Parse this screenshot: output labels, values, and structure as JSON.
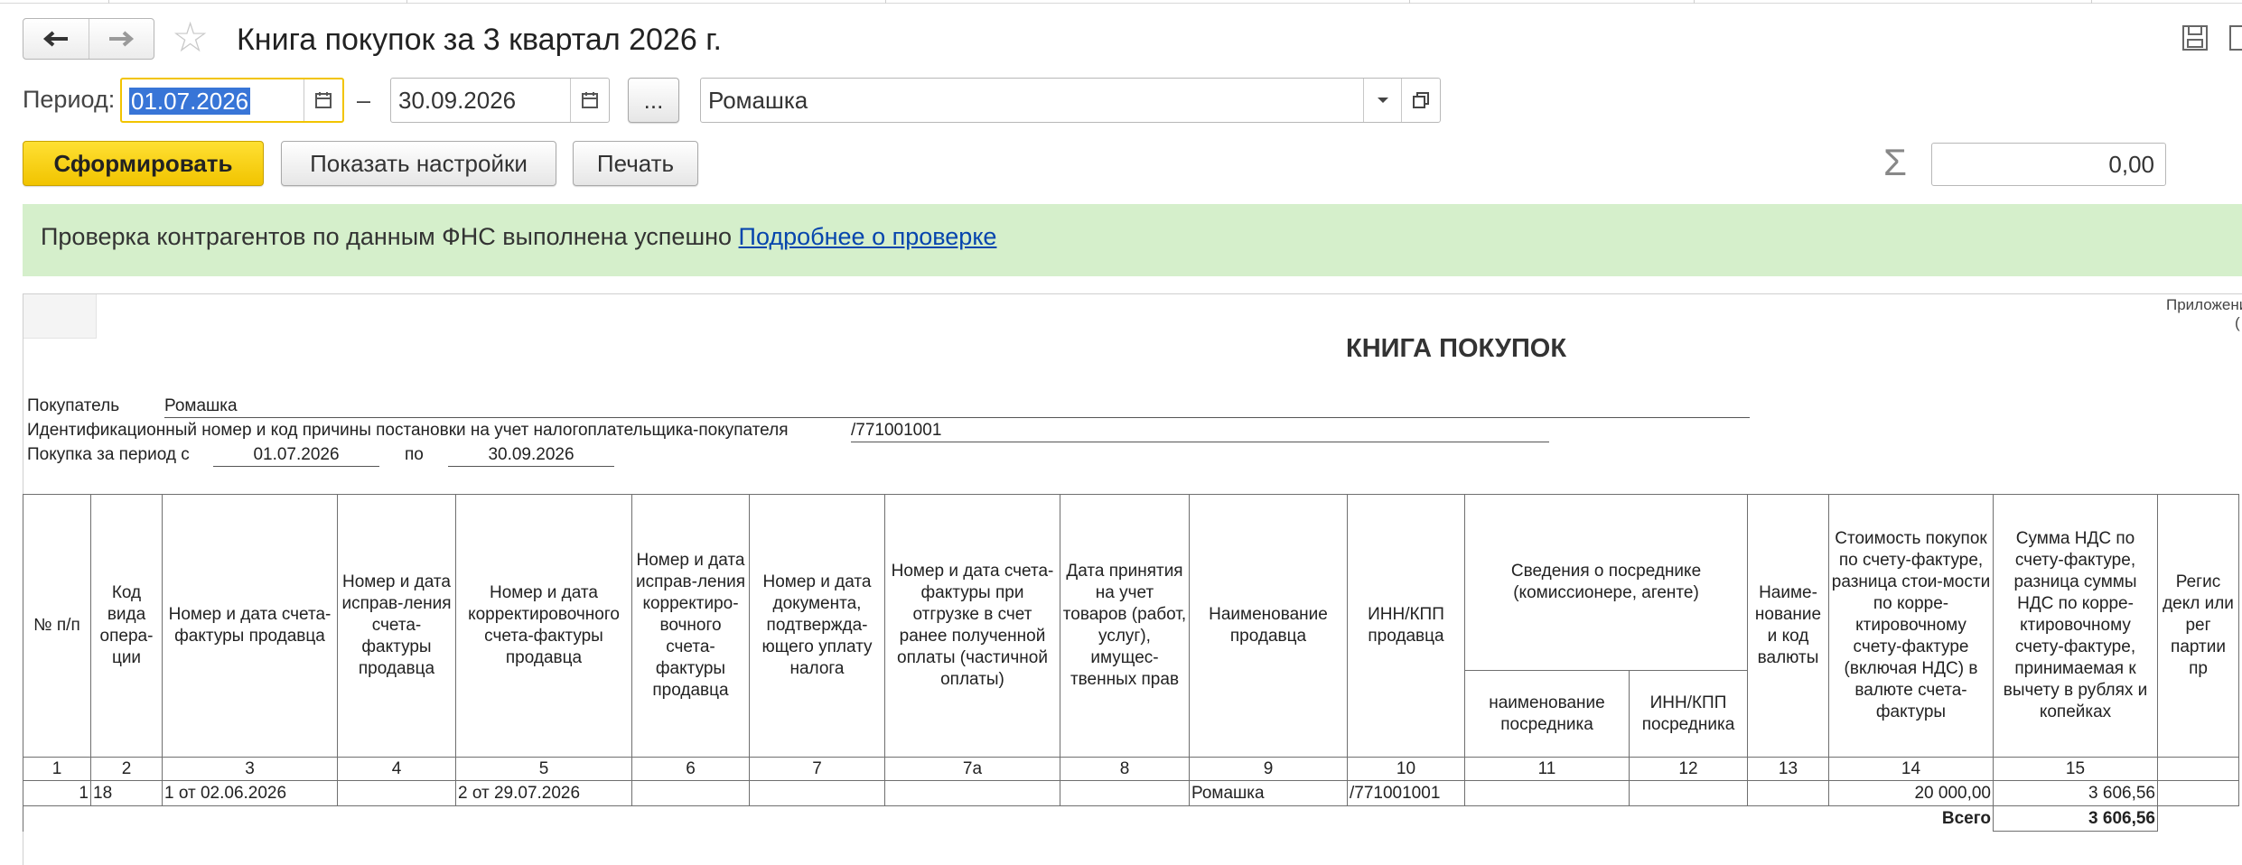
{
  "window": {
    "title": "Книга покупок за 3 квартал 2026 г.",
    "back_icon": "arrow-left-icon",
    "forward_icon": "arrow-right-icon",
    "favorite_icon": "star-icon"
  },
  "filters": {
    "period_label": "Период:",
    "date_from": "01.07.2026",
    "dash": "–",
    "date_to": "30.09.2026",
    "more_button": "...",
    "organization": "Ромашка"
  },
  "toolbar": {
    "generate_label": "Сформировать",
    "settings_label": "Показать настройки",
    "print_label": "Печать",
    "sum_icon": "Σ",
    "sum_value": "0,00"
  },
  "banner": {
    "text": "Проверка контрагентов по данным ФНС выполнена успешно",
    "link": "Подробнее о проверке"
  },
  "report": {
    "appendix": "Приложени",
    "appendix2": "(",
    "title": "КНИГА ПОКУПОК",
    "buyer_label": "Покупатель",
    "buyer_value": "Ромашка",
    "inn_label": "Идентификационный номер и код причины постановки на учет налогоплательщика-покупателя",
    "inn_value": "/771001001",
    "period_label": "Покупка за период с",
    "period_from": "01.07.2026",
    "period_to_label": "по",
    "period_to": "30.09.2026",
    "headers": {
      "c1": "№ п/п",
      "c2": "Код вида опера-ции",
      "c3": "Номер и дата счета-фактуры продавца",
      "c4": "Номер и дата исправ-ления счета-фактуры продавца",
      "c5": "Номер и дата корректировочного счета-фактуры продавца",
      "c6": "Номер и дата исправ-ления корректиро-вочного счета-фактуры продавца",
      "c7": "Номер и дата документа, подтвержда-ющего уплату налога",
      "c7a": "Номер и дата счета-фактуры при отгрузке в счет ранее полученной оплаты (частичной оплаты)",
      "c8": "Дата принятия на учет товаров (работ, услуг), имущес-твенных прав",
      "c9": "Наименование продавца",
      "c10": "ИНН/КПП продавца",
      "c11_12": "Сведения о посреднике (комиссионере, агенте)",
      "c11": "наименование посредника",
      "c12": "ИНН/КПП посредника",
      "c13": "Наиме-нование и код валюты",
      "c14": "Стоимость покупок по счету-фактуре, разница стои-мости по корре-ктировочному счету-фактуре (включая НДС) в валюте счета-фактуры",
      "c15": "Сумма НДС по счету-фактуре, разница суммы НДС по корре-ктировочному счету-фактуре, принимаемая к вычету в рублях и копейках",
      "c16": "Регис декл или рег партии пр"
    },
    "col_numbers": [
      "1",
      "2",
      "3",
      "4",
      "5",
      "6",
      "7",
      "7а",
      "8",
      "9",
      "10",
      "11",
      "12",
      "13",
      "14",
      "15",
      ""
    ],
    "rows": [
      {
        "n": "1",
        "code": "18",
        "invoice": "1 от 02.06.2026",
        "fix": "",
        "corr": "2 от 29.07.2026",
        "corr_fix": "",
        "pay_doc": "",
        "prepay": "",
        "date": "",
        "seller": "Ромашка",
        "inn": "/771001001",
        "agent": "",
        "agent_inn": "",
        "currency": "",
        "cost": "20 000,00",
        "vat": "3 606,56",
        "extra": ""
      }
    ],
    "total_label": "Всего",
    "total_vat": "3 606,56"
  }
}
